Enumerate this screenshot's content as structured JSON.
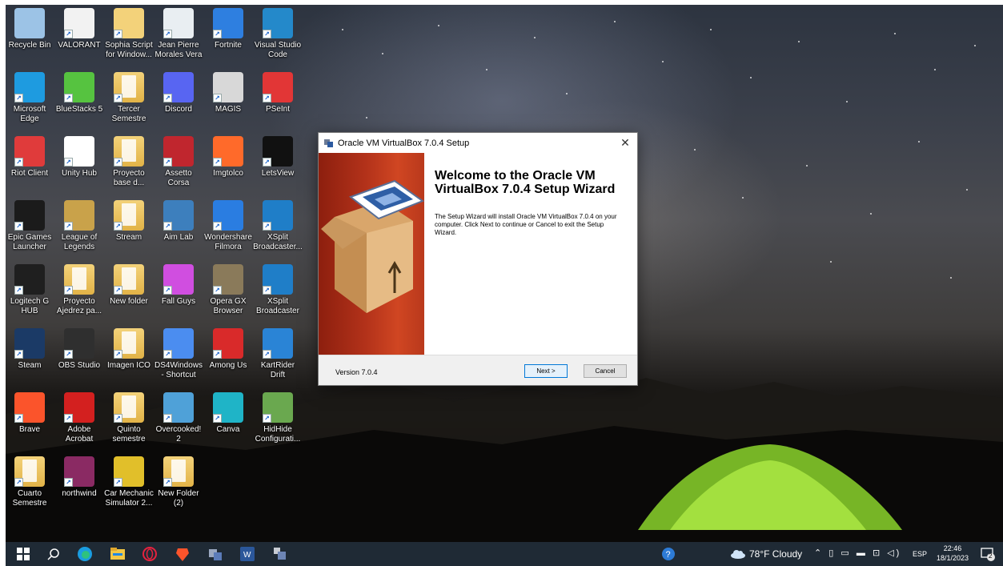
{
  "desktop_icons": [
    {
      "label": "Recycle Bin",
      "icon": "recycle-bin-icon"
    },
    {
      "label": "VALORANT",
      "icon": "valorant-icon"
    },
    {
      "label": "Sophia Script for Window...",
      "icon": "script-file-icon"
    },
    {
      "label": "Jean Pierre Morales Vera",
      "icon": "excel-file-icon"
    },
    {
      "label": "Fortnite",
      "icon": "fortnite-icon"
    },
    {
      "label": "Visual Studio Code",
      "icon": "vscode-icon"
    },
    {
      "label": "Microsoft Edge",
      "icon": "edge-icon"
    },
    {
      "label": "BlueStacks 5",
      "icon": "bluestacks-icon"
    },
    {
      "label": "Tercer Semestre",
      "icon": "folder-icon"
    },
    {
      "label": "Discord",
      "icon": "discord-icon"
    },
    {
      "label": "MAGIS",
      "icon": "magis-icon"
    },
    {
      "label": "PSeInt",
      "icon": "pseint-icon"
    },
    {
      "label": "Riot Client",
      "icon": "riot-client-icon"
    },
    {
      "label": "Unity Hub",
      "icon": "unity-hub-icon"
    },
    {
      "label": "Proyecto base d...",
      "icon": "folder-icon"
    },
    {
      "label": "Assetto Corsa",
      "icon": "assetto-corsa-icon"
    },
    {
      "label": "Imgtolco",
      "icon": "imgtoico-icon"
    },
    {
      "label": "LetsView",
      "icon": "letsview-icon"
    },
    {
      "label": "Epic Games Launcher",
      "icon": "epic-games-icon"
    },
    {
      "label": "League of Legends",
      "icon": "league-of-legends-icon"
    },
    {
      "label": "Stream",
      "icon": "folder-icon"
    },
    {
      "label": "Aim Lab",
      "icon": "aim-lab-icon"
    },
    {
      "label": "Wondershare Filmora",
      "icon": "filmora-icon"
    },
    {
      "label": "XSplit Broadcaster...",
      "icon": "xsplit-icon"
    },
    {
      "label": "Logitech G HUB",
      "icon": "logitech-ghub-icon"
    },
    {
      "label": "Proyecto Ajedrez pa...",
      "icon": "folder-icon"
    },
    {
      "label": "New folder",
      "icon": "folder-icon"
    },
    {
      "label": "Fall Guys",
      "icon": "fall-guys-icon"
    },
    {
      "label": "Opera GX Browser",
      "icon": "opera-gx-icon"
    },
    {
      "label": "XSplit Broadcaster",
      "icon": "xsplit-icon"
    },
    {
      "label": "Steam",
      "icon": "steam-icon"
    },
    {
      "label": "OBS Studio",
      "icon": "obs-studio-icon"
    },
    {
      "label": "Imagen ICO",
      "icon": "folder-icon"
    },
    {
      "label": "DS4Windows - Shortcut",
      "icon": "ds4windows-icon"
    },
    {
      "label": "Among Us",
      "icon": "among-us-icon"
    },
    {
      "label": "KartRider Drift",
      "icon": "kartrider-icon"
    },
    {
      "label": "Brave",
      "icon": "brave-icon"
    },
    {
      "label": "Adobe Acrobat",
      "icon": "adobe-acrobat-icon"
    },
    {
      "label": "Quinto semestre",
      "icon": "folder-icon"
    },
    {
      "label": "Overcooked! 2",
      "icon": "overcooked-icon"
    },
    {
      "label": "Canva",
      "icon": "canva-icon"
    },
    {
      "label": "HidHide Configurati...",
      "icon": "hidhide-icon"
    },
    {
      "label": "Cuarto Semestre",
      "icon": "folder-icon"
    },
    {
      "label": "northwind",
      "icon": "winrar-icon"
    },
    {
      "label": "Car Mechanic Simulator 2...",
      "icon": "car-mechanic-icon"
    },
    {
      "label": "New Folder (2)",
      "icon": "folder-icon"
    }
  ],
  "dialog": {
    "title": "Oracle VM VirtualBox 7.0.4 Setup",
    "heading": "Welcome to the Oracle VM VirtualBox 7.0.4 Setup Wizard",
    "body": "The Setup Wizard will install Oracle VM VirtualBox 7.0.4 on your computer. Click Next to continue or Cancel to exit the Setup Wizard.",
    "version": "Version 7.0.4",
    "next_label": "Next >",
    "cancel_label": "Cancel",
    "close_label": "✕"
  },
  "taskbar": {
    "weather": "78°F Cloudy",
    "language": "ESP",
    "time": "22:46",
    "date": "18/1/2023",
    "notification_count": "2"
  }
}
